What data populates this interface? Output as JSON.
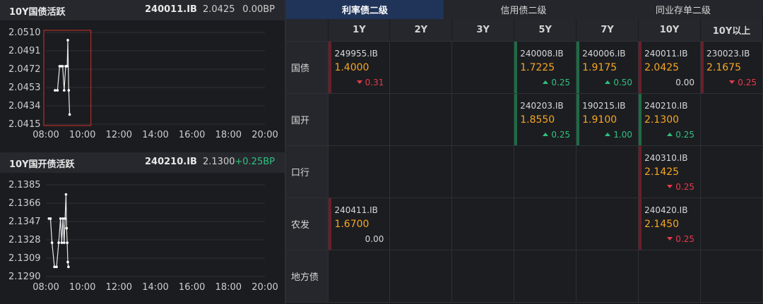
{
  "colors": {
    "up": "#2ec27e",
    "down": "#e8394a",
    "flat": "#d8d8d8",
    "yield": "#f5a623",
    "bar_up": "#1f6b45",
    "bar_down": "#6b1f2a",
    "active_tab": "#20345a"
  },
  "charts": [
    {
      "title": "10Y国债活跃",
      "code": "240011.IB",
      "yield": "2.0425",
      "bp": "0.00BP",
      "bp_dir": "flat",
      "chart_data": {
        "type": "line",
        "x_ticks": [
          "08:00",
          "10:00",
          "12:00",
          "14:00",
          "16:00",
          "18:00",
          "20:00"
        ],
        "y_ticks": [
          "2.0510",
          "2.0491",
          "2.0472",
          "2.0453",
          "2.0434",
          "2.0415"
        ],
        "xlim": [
          "08:00",
          "20:00"
        ],
        "ylim": [
          2.0415,
          2.051
        ],
        "highlight_box": [
          "08:00",
          "10:00"
        ],
        "points": [
          [
            "08:30",
            2.045
          ],
          [
            "08:38",
            2.045
          ],
          [
            "08:45",
            2.0475
          ],
          [
            "08:50",
            2.0475
          ],
          [
            "08:55",
            2.0475
          ],
          [
            "09:00",
            2.045
          ],
          [
            "09:05",
            2.0475
          ],
          [
            "09:08",
            2.0475
          ],
          [
            "09:10",
            2.0475
          ],
          [
            "09:12",
            2.0502
          ],
          [
            "09:15",
            2.045
          ],
          [
            "09:18",
            2.0425
          ]
        ]
      }
    },
    {
      "title": "10Y国开债活跃",
      "code": "240210.IB",
      "yield": "2.1300",
      "bp": "+0.25BP",
      "bp_dir": "up",
      "chart_data": {
        "type": "line",
        "x_ticks": [
          "08:00",
          "10:00",
          "12:00",
          "14:00",
          "16:00",
          "18:00",
          "20:00"
        ],
        "y_ticks": [
          "2.1385",
          "2.1366",
          "2.1347",
          "2.1328",
          "2.1309",
          "2.1290"
        ],
        "xlim": [
          "08:00",
          "20:00"
        ],
        "ylim": [
          2.129,
          2.1385
        ],
        "points": [
          [
            "08:10",
            2.135
          ],
          [
            "08:15",
            2.135
          ],
          [
            "08:20",
            2.1325
          ],
          [
            "08:28",
            2.13
          ],
          [
            "08:35",
            2.13
          ],
          [
            "08:42",
            2.1325
          ],
          [
            "08:48",
            2.135
          ],
          [
            "08:52",
            2.1325
          ],
          [
            "08:56",
            2.135
          ],
          [
            "09:00",
            2.1325
          ],
          [
            "09:03",
            2.135
          ],
          [
            "09:06",
            2.1375
          ],
          [
            "09:08",
            2.134
          ],
          [
            "09:10",
            2.1325
          ],
          [
            "09:12",
            2.1305
          ],
          [
            "09:14",
            2.13
          ]
        ]
      }
    }
  ],
  "tabs": [
    {
      "label": "利率债二级",
      "active": true
    },
    {
      "label": "信用债二级",
      "active": false
    },
    {
      "label": "同业存单二级",
      "active": false
    }
  ],
  "columns": [
    "1Y",
    "2Y",
    "3Y",
    "5Y",
    "7Y",
    "10Y",
    "10Y以上"
  ],
  "rows": [
    {
      "label": "国债",
      "cells": [
        {
          "code": "249955.IB",
          "yield": "1.4000",
          "chg": "0.31",
          "dir": "down"
        },
        null,
        null,
        {
          "code": "240008.IB",
          "yield": "1.7225",
          "chg": "0.25",
          "dir": "up"
        },
        {
          "code": "240006.IB",
          "yield": "1.9175",
          "chg": "0.50",
          "dir": "up"
        },
        {
          "code": "240011.IB",
          "yield": "2.0425",
          "chg": "0.00",
          "dir": "flat"
        },
        {
          "code": "230023.IB",
          "yield": "2.1675",
          "chg": "0.25",
          "dir": "down"
        }
      ]
    },
    {
      "label": "国开",
      "cells": [
        null,
        null,
        null,
        {
          "code": "240203.IB",
          "yield": "1.8550",
          "chg": "0.25",
          "dir": "up"
        },
        {
          "code": "190215.IB",
          "yield": "1.9100",
          "chg": "1.00",
          "dir": "up"
        },
        {
          "code": "240210.IB",
          "yield": "2.1300",
          "chg": "0.25",
          "dir": "up"
        },
        null
      ]
    },
    {
      "label": "口行",
      "cells": [
        null,
        null,
        null,
        null,
        null,
        {
          "code": "240310.IB",
          "yield": "2.1425",
          "chg": "0.25",
          "dir": "down"
        },
        null
      ]
    },
    {
      "label": "农发",
      "cells": [
        {
          "code": "240411.IB",
          "yield": "1.6700",
          "chg": "0.00",
          "dir": "flat"
        },
        null,
        null,
        null,
        null,
        {
          "code": "240420.IB",
          "yield": "2.1450",
          "chg": "0.25",
          "dir": "down"
        },
        null
      ]
    },
    {
      "label": "地方债",
      "cells": [
        null,
        null,
        null,
        null,
        null,
        null,
        null
      ]
    }
  ]
}
